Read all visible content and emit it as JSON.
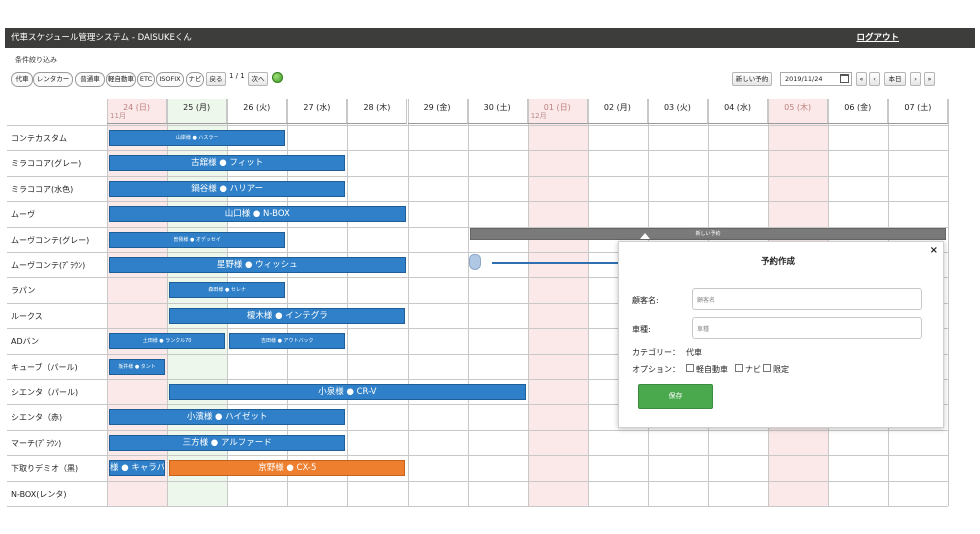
{
  "header": {
    "title": "代車スケジュール管理システム - DAISUKEくん",
    "logout": "ログアウト"
  },
  "filter": {
    "caption": "条件絞り込み",
    "chips": [
      "代車",
      "レンタカー",
      "普通車",
      "軽自動車",
      "ETC",
      "ISOFIX",
      "ナビ"
    ],
    "back": "戻る",
    "page": "1 / 1",
    "next": "次へ"
  },
  "toolbar": {
    "new_reservation": "新しい予約",
    "date_value": "2019/11/24",
    "nav_prev_fast": "«",
    "nav_prev": "‹",
    "today": "本日",
    "nav_next": "›",
    "nav_next_fast": "»"
  },
  "calendar": {
    "days": [
      {
        "label": "24 (日)",
        "month": "11月",
        "kind": "holiday"
      },
      {
        "label": "25 (月)",
        "month": "",
        "kind": "today"
      },
      {
        "label": "26 (火)",
        "month": "",
        "kind": "normal"
      },
      {
        "label": "27 (水)",
        "month": "",
        "kind": "normal"
      },
      {
        "label": "28 (木)",
        "month": "",
        "kind": "normal"
      },
      {
        "label": "29 (金)",
        "month": "",
        "kind": "normal"
      },
      {
        "label": "30 (土)",
        "month": "",
        "kind": "normal"
      },
      {
        "label": "01 (日)",
        "month": "12月",
        "kind": "holiday"
      },
      {
        "label": "02 (月)",
        "month": "",
        "kind": "normal"
      },
      {
        "label": "03 (火)",
        "month": "",
        "kind": "normal"
      },
      {
        "label": "04 (水)",
        "month": "",
        "kind": "normal"
      },
      {
        "label": "05 (木)",
        "month": "",
        "kind": "holiday"
      },
      {
        "label": "06 (金)",
        "month": "",
        "kind": "normal"
      },
      {
        "label": "07 (土)",
        "month": "",
        "kind": "normal"
      }
    ],
    "cars": [
      "コンテカスタム",
      "ミラココア(グレー)",
      "ミラココア(水色)",
      "ムーヴ",
      "ムーヴコンテ(グレー)",
      "ムーヴコンテ(ｱﾞﾗｳﾝ)",
      "ラパン",
      "ルークス",
      "ADバン",
      "キューブ（パール)",
      "シエンタ（パール)",
      "シエンタ（赤)",
      "マーチ(ｱﾞﾗｳﾝ)",
      "下取りデミオ（黒)",
      "N-BOX(レンタ)"
    ],
    "reservations": [
      {
        "row": 0,
        "start": 0,
        "end": 3,
        "label": "山岸様 ● ハスラー",
        "color": "blue",
        "size": "small"
      },
      {
        "row": 1,
        "start": 0,
        "end": 4,
        "label": "古舘様 ● フィット",
        "color": "blue",
        "size": "big"
      },
      {
        "row": 2,
        "start": 0,
        "end": 4,
        "label": "鍋谷様 ● ハリアー",
        "color": "blue",
        "size": "big"
      },
      {
        "row": 3,
        "start": 0,
        "end": 5,
        "label": "山口様 ● N-BOX",
        "color": "blue",
        "size": "big"
      },
      {
        "row": 4,
        "start": 0,
        "end": 3,
        "label": "曽我様 ● オデッセイ",
        "color": "blue",
        "size": "small"
      },
      {
        "row": 4,
        "start": 6,
        "end": 14,
        "label": "新しい予約",
        "color": "gray",
        "size": "small"
      },
      {
        "row": 5,
        "start": 0,
        "end": 5,
        "label": "星野様 ● ウィッシュ",
        "color": "blue",
        "size": "big"
      },
      {
        "row": 6,
        "start": 1,
        "end": 3,
        "label": "森田様 ● セレナ",
        "color": "blue",
        "size": "small"
      },
      {
        "row": 7,
        "start": 1,
        "end": 5,
        "label": "榎木様 ● インテグラ",
        "color": "blue",
        "size": "big"
      },
      {
        "row": 8,
        "start": 0,
        "end": 2,
        "label": "土田様 ● ランクル70",
        "color": "blue",
        "size": "small"
      },
      {
        "row": 8,
        "start": 2,
        "end": 4,
        "label": "吉田様 ● アウトバック",
        "color": "blue",
        "size": "small"
      },
      {
        "row": 9,
        "start": 0,
        "end": 1,
        "label": "坂井様 ● タント",
        "color": "blue",
        "size": "small"
      },
      {
        "row": 10,
        "start": 1,
        "end": 7,
        "label": "小泉様 ● CR-V",
        "color": "blue",
        "size": "big"
      },
      {
        "row": 11,
        "start": 0,
        "end": 4,
        "label": "小濱様 ● ハイゼット",
        "color": "blue",
        "size": "big"
      },
      {
        "row": 12,
        "start": 0,
        "end": 4,
        "label": "三方様 ● アルファード",
        "color": "blue",
        "size": "big"
      },
      {
        "row": 13,
        "start": 0,
        "end": 1,
        "label": "様 ● キャラバン",
        "color": "blue",
        "size": "big"
      },
      {
        "row": 13,
        "start": 1,
        "end": 5,
        "label": "京野様 ● CX-5",
        "color": "orange",
        "size": "big"
      }
    ]
  },
  "modal": {
    "title": "予約作成",
    "close": "×",
    "customer_label": "顧客名:",
    "customer_placeholder": "顧客名",
    "model_label": "車種:",
    "model_placeholder": "車種",
    "category_label": "カテゴリー：",
    "category_value": "代車",
    "option_label": "オプション：",
    "options": [
      "軽自動車",
      "ナビ",
      "限定"
    ],
    "save": "保存"
  },
  "colors": {
    "topbar": "#3d3d3b",
    "reservation_blue": "#2f80c8",
    "reservation_orange": "#ee7f2f",
    "holiday_column": "#fbe9e9",
    "today_column": "#eef7ec",
    "save_green": "#4aa94d"
  },
  "icons": [
    "calendar-icon",
    "status-dot-icon",
    "close-icon",
    "drag-arrow-icon",
    "hand-cursor-icon"
  ]
}
